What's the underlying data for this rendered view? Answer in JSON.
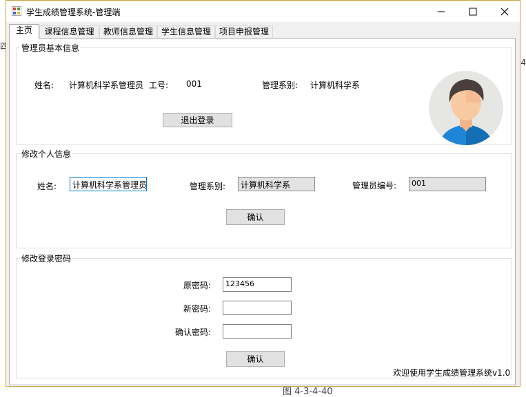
{
  "window": {
    "title": "学生成绩管理系统-管理端"
  },
  "tabs": [
    "主页",
    "课程信息管理",
    "教师信息管理",
    "学生信息管理",
    "项目申报管理"
  ],
  "admin_info": {
    "group_title": "管理员基本信息",
    "name_label": "姓名:",
    "name_value": "计算机科学系管理员",
    "id_label": "工号:",
    "id_value": "001",
    "dept_label": "管理系别:",
    "dept_value": "计算机科学系",
    "logout_label": "退出登录"
  },
  "edit_info": {
    "group_title": "修改个人信息",
    "name_label": "姓名:",
    "name_value": "计算机科学系管理员",
    "dept_label": "管理系别:",
    "dept_value": "计算机科学系",
    "number_label": "管理员编号:",
    "number_value": "001",
    "confirm_label": "确认"
  },
  "password": {
    "group_title": "修改登录密码",
    "old_label": "原密码:",
    "old_value": "123456",
    "new_label": "新密码:",
    "new_value": "",
    "confirm_pw_label": "确认密码:",
    "confirm_pw_value": "",
    "confirm_label": "确认"
  },
  "footer_text": "欢迎使用学生成绩管理系统v1.0",
  "background": {
    "left_text": "四",
    "right_text": "4",
    "caption": "图 4-3-4-40"
  }
}
